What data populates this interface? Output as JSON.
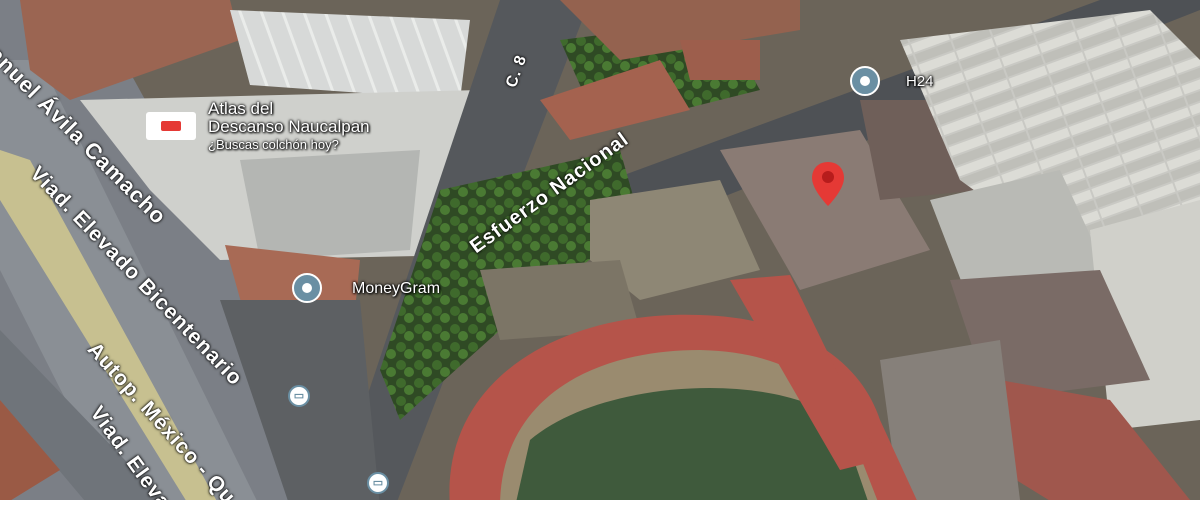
{
  "map": {
    "pois": {
      "atlas": {
        "name_line1": "Atlas del",
        "name_line2": "Descanso Naucalpan",
        "subtitle": "¿Buscas colchón hoy?"
      },
      "moneygram": {
        "name": "MoneyGram"
      },
      "h24": {
        "name": "H24"
      }
    },
    "roads": {
      "avila_camacho": "Manuel Ávila Camacho",
      "viad_elevado_bicentenario": "Viad. Elevado Bicentenario",
      "autop_mexico": "Autop. México - Qu",
      "viad_elevado_2": "Viad. Eleva",
      "c8": "C. 8",
      "esfuerzo_nacional": "Esfuerzo Nacional"
    },
    "colors": {
      "pin": "#e53935",
      "poi": "#6a8fa3",
      "track": "#b5544a",
      "field": "#3f5a3c"
    },
    "icons": [
      "store-icon",
      "poi-icon",
      "bus-stop-icon",
      "location-pin-icon"
    ]
  }
}
